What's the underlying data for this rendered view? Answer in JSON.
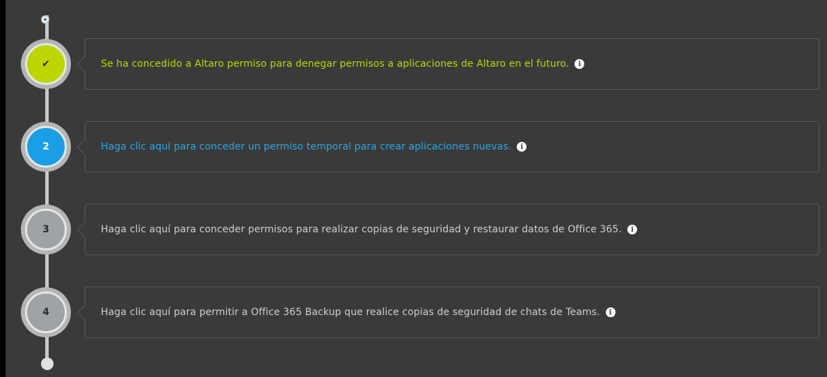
{
  "colors": {
    "done": "#bdd600",
    "active": "#1a9ee6",
    "pending": "#9ea3a6",
    "done_text": "#bdd600",
    "active_text": "#2aa7e8",
    "pending_text": "#cfcfcf"
  },
  "steps": [
    {
      "marker": "✔",
      "status": "done",
      "text": "Se ha concedido a Altaro permiso para denegar permisos a aplicaciones de Altaro en el futuro.",
      "info_icon": "info-icon"
    },
    {
      "marker": "2",
      "status": "active",
      "text": "Haga clic aquí para conceder un permiso temporal para crear aplicaciones nuevas.",
      "info_icon": "info-icon"
    },
    {
      "marker": "3",
      "status": "pending",
      "text": "Haga clic aquí para conceder permisos para realizar copias de seguridad y restaurar datos de Office 365.",
      "info_icon": "info-icon"
    },
    {
      "marker": "4",
      "status": "pending",
      "text": "Haga clic aquí para permitir a Office 365 Backup que realice copias de seguridad de chats de Teams.",
      "info_icon": "info-icon"
    }
  ],
  "info_glyph": "i"
}
